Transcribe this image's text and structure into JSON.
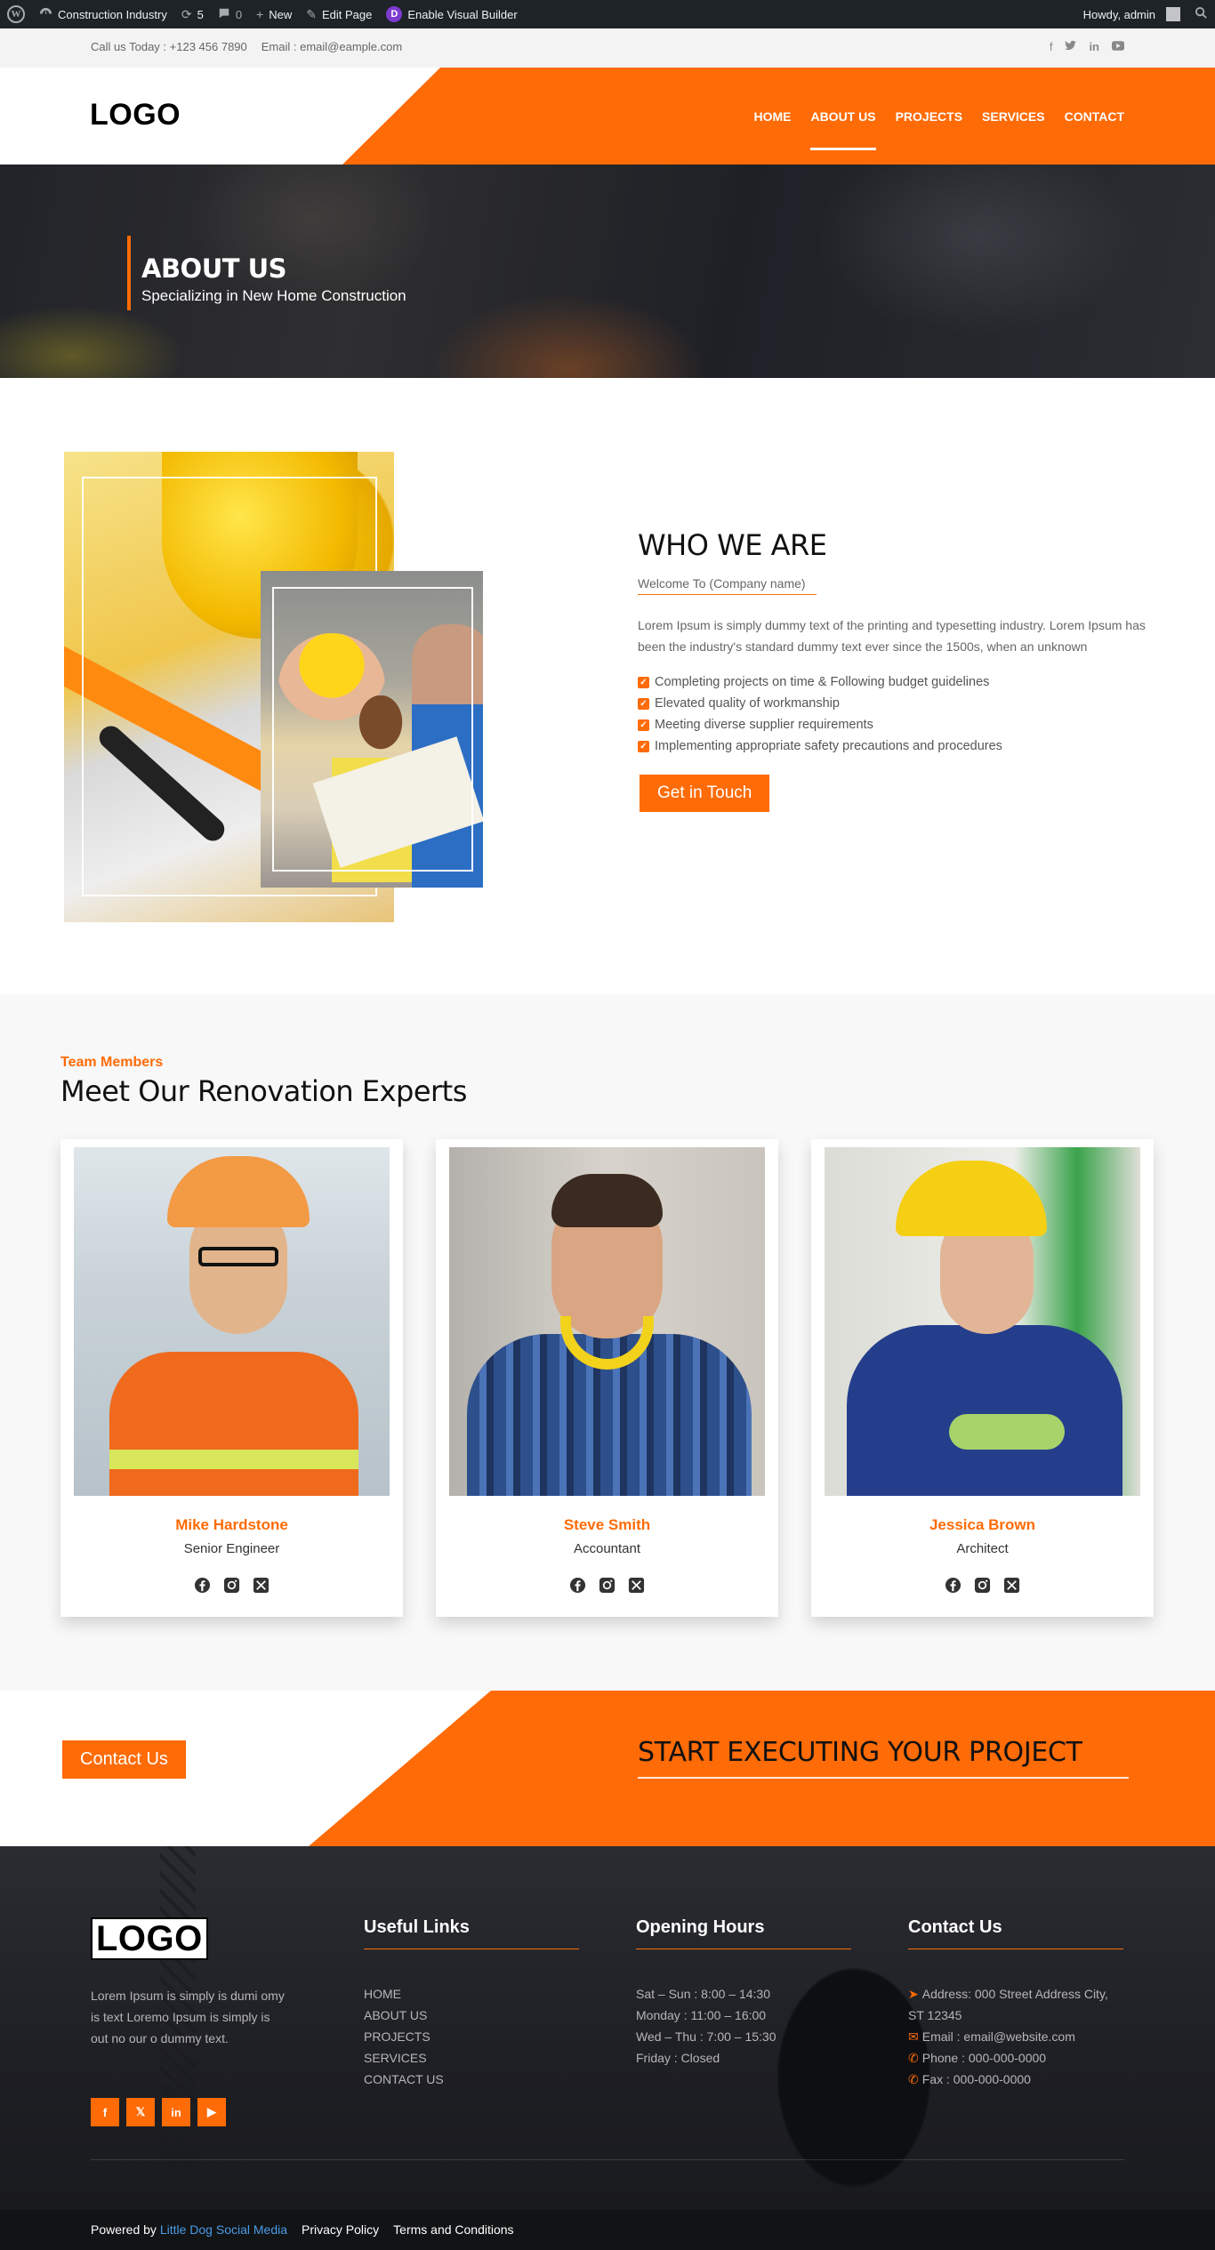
{
  "admin_bar": {
    "site_name": "Construction Industry",
    "updates_count": "5",
    "comments_count": "0",
    "new_label": "New",
    "edit_label": "Edit Page",
    "builder_label": "Enable Visual Builder",
    "greeting": "Howdy, admin"
  },
  "topbar": {
    "phone": "Call us Today : +123 456 7890",
    "email": "Email : email@eample.com",
    "social_icons": [
      "facebook-icon",
      "twitter-icon",
      "linkedin-icon",
      "youtube-icon"
    ]
  },
  "header": {
    "logo": "LOGO",
    "nav": [
      "HOME",
      "ABOUT US",
      "PROJECTS",
      "SERVICES",
      "CONTACT"
    ],
    "active_nav": "ABOUT US"
  },
  "hero": {
    "title": "ABOUT US",
    "subtitle": "Specializing in New Home Construction"
  },
  "who": {
    "title": "WHO WE ARE",
    "subtitle": "Welcome To (Company name)",
    "description": "Lorem Ipsum is simply dummy text of the printing and typesetting industry. Lorem Ipsum has been the industry's standard dummy text ever since the 1500s, when an unknown",
    "bullets": [
      "Completing projects on time & Following budget guidelines",
      "Elevated quality of workmanship",
      "Meeting diverse supplier requirements",
      "Implementing appropriate safety precautions and procedures"
    ],
    "button": "Get in Touch"
  },
  "team": {
    "eyebrow": "Team Members",
    "title": "Meet Our Renovation Experts",
    "members": [
      {
        "name": "Mike Hardstone",
        "role": "Senior Engineer"
      },
      {
        "name": "Steve Smith",
        "role": "Accountant"
      },
      {
        "name": "Jessica Brown",
        "role": "Architect"
      }
    ]
  },
  "cta": {
    "button": "Contact Us",
    "title": "START EXECUTING YOUR PROJECT"
  },
  "footer": {
    "logo": "LOGO",
    "about": "Lorem Ipsum is simply is dumi omy is text Loremo Ipsum is simply is out no our o dummy text.",
    "useful_links": {
      "title": "Useful Links",
      "items": [
        "HOME",
        "ABOUT US",
        "PROJECTS",
        "SERVICES",
        "CONTACT US"
      ]
    },
    "opening_hours": {
      "title": "Opening Hours",
      "items": [
        "Sat – Sun : 8:00 – 14:30",
        "Monday : 11:00 – 16:00",
        "Wed – Thu : 7:00 – 15:30",
        "Friday : Closed"
      ]
    },
    "contact": {
      "title": "Contact Us",
      "address": "Address: 000 Street Address City, ST 12345",
      "email": "Email : email@website.com",
      "phone": "Phone : 000-000-0000",
      "fax": "Fax : 000-000-0000"
    }
  },
  "bottom_bar": {
    "powered_prefix": "Powered by",
    "powered_link": "Little Dog Social Media",
    "privacy": "Privacy Policy",
    "terms": "Terms and Conditions"
  },
  "colors": {
    "accent": "#ff6b06",
    "admin_bar": "#1d2327",
    "footer_bg": "#1e1f24"
  }
}
